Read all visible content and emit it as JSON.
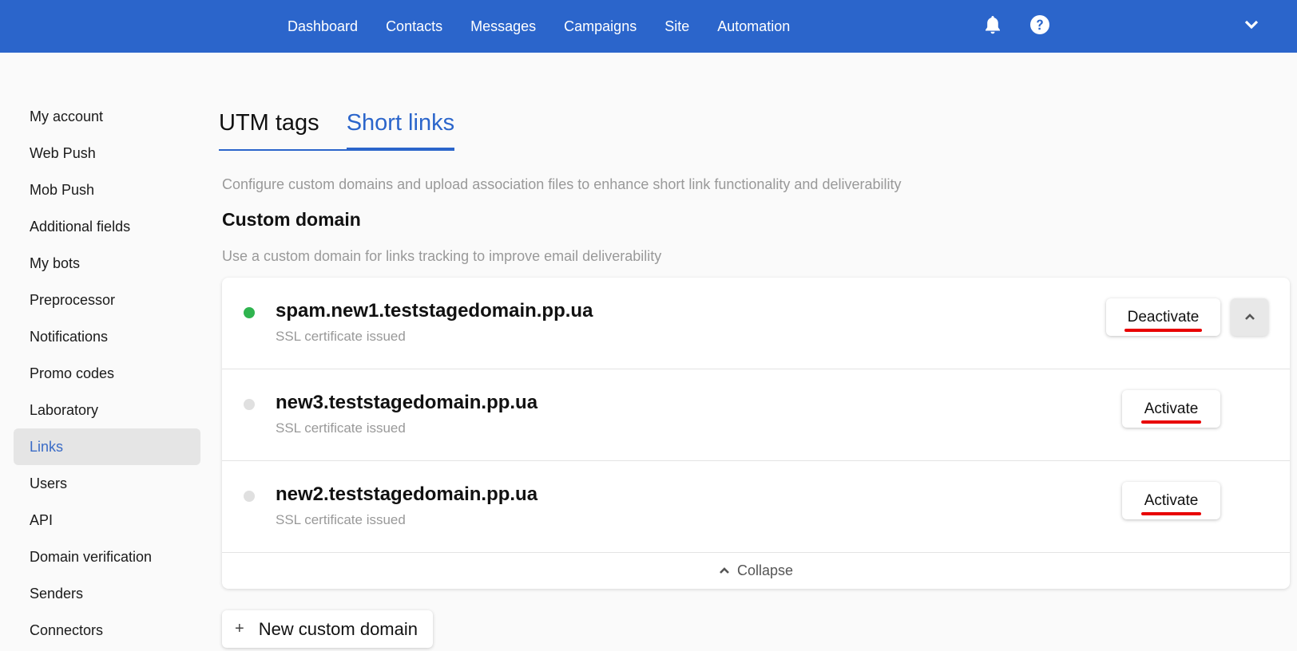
{
  "topnav": {
    "items": [
      "Dashboard",
      "Contacts",
      "Messages",
      "Campaigns",
      "Site",
      "Automation"
    ],
    "icons": [
      "bell-icon",
      "help-icon",
      "chevron-down-icon"
    ]
  },
  "sidebar": {
    "items": [
      {
        "label": "My account"
      },
      {
        "label": "Web Push"
      },
      {
        "label": "Mob Push"
      },
      {
        "label": "Additional fields"
      },
      {
        "label": "My bots"
      },
      {
        "label": "Preprocessor"
      },
      {
        "label": "Notifications"
      },
      {
        "label": "Promo codes"
      },
      {
        "label": "Laboratory"
      },
      {
        "label": "Links",
        "active": true
      },
      {
        "label": "Users"
      },
      {
        "label": "API"
      },
      {
        "label": "Domain verification"
      },
      {
        "label": "Senders"
      },
      {
        "label": "Connectors"
      }
    ]
  },
  "tabs": [
    {
      "label": "UTM tags",
      "active": false
    },
    {
      "label": "Short links",
      "active": true
    }
  ],
  "main": {
    "description": "Configure custom domains and upload association files to enhance short link functionality and deliverability",
    "section_title": "Custom domain",
    "section_subtitle": "Use a custom domain for links tracking to improve email deliverability",
    "domains": [
      {
        "name": "spam.new1.teststagedomain.pp.ua",
        "status": "SSL certificate issued",
        "active": true,
        "action": "Deactivate"
      },
      {
        "name": "new3.teststagedomain.pp.ua",
        "status": "SSL certificate issued",
        "active": false,
        "action": "Activate"
      },
      {
        "name": "new2.teststagedomain.pp.ua",
        "status": "SSL certificate issued",
        "active": false,
        "action": "Activate"
      }
    ],
    "collapse_label": "Collapse",
    "new_domain_label": "New custom domain",
    "new_domain_icon": "+"
  },
  "colors": {
    "header": "#2b65cb",
    "accent": "#2b65cb",
    "active_dot": "#2fb44f",
    "inactive_dot": "#e0e0e0",
    "annotation_underline": "#e80000"
  }
}
